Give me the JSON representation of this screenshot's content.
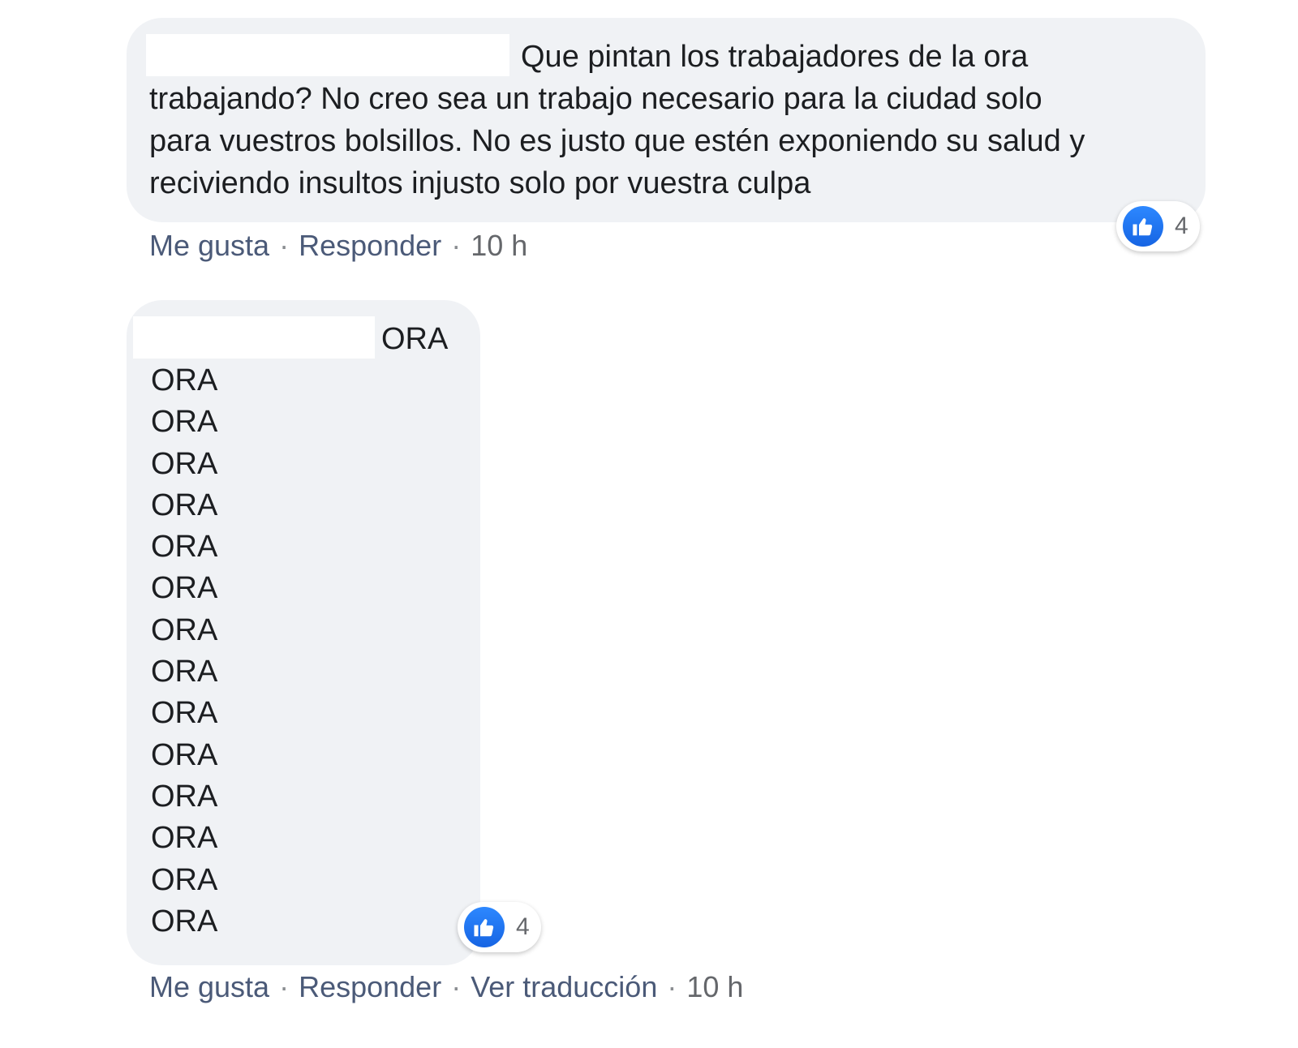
{
  "comments": [
    {
      "text_first_line": "Que pintan los trabajadores de la ora",
      "text_rest": "trabajando? No creo sea un trabajo necesario para la ciudad solo\npara vuestros bolsillos. No es justo que estén exponiendo su salud y\nreciviendo insultos injusto solo por vuestra culpa",
      "reaction": {
        "icon": "like-icon",
        "count": "4"
      },
      "actions": {
        "like": "Me gusta",
        "reply": "Responder",
        "time": "10 h"
      }
    },
    {
      "text_first_line": "ORA",
      "lines": [
        "ORA",
        "ORA",
        "ORA",
        "ORA",
        "ORA",
        "ORA",
        "ORA",
        "ORA",
        "ORA",
        "ORA",
        "ORA",
        "ORA",
        "ORA",
        "ORA"
      ],
      "reaction": {
        "icon": "like-icon",
        "count": "4"
      },
      "actions": {
        "like": "Me gusta",
        "reply": "Responder",
        "translate": "Ver traducción",
        "time": "10 h"
      }
    }
  ],
  "colors": {
    "bubble": "#f0f2f5",
    "like_blue": "#1877f2",
    "meta_text": "#65676b",
    "link_text": "#4b5a78"
  }
}
